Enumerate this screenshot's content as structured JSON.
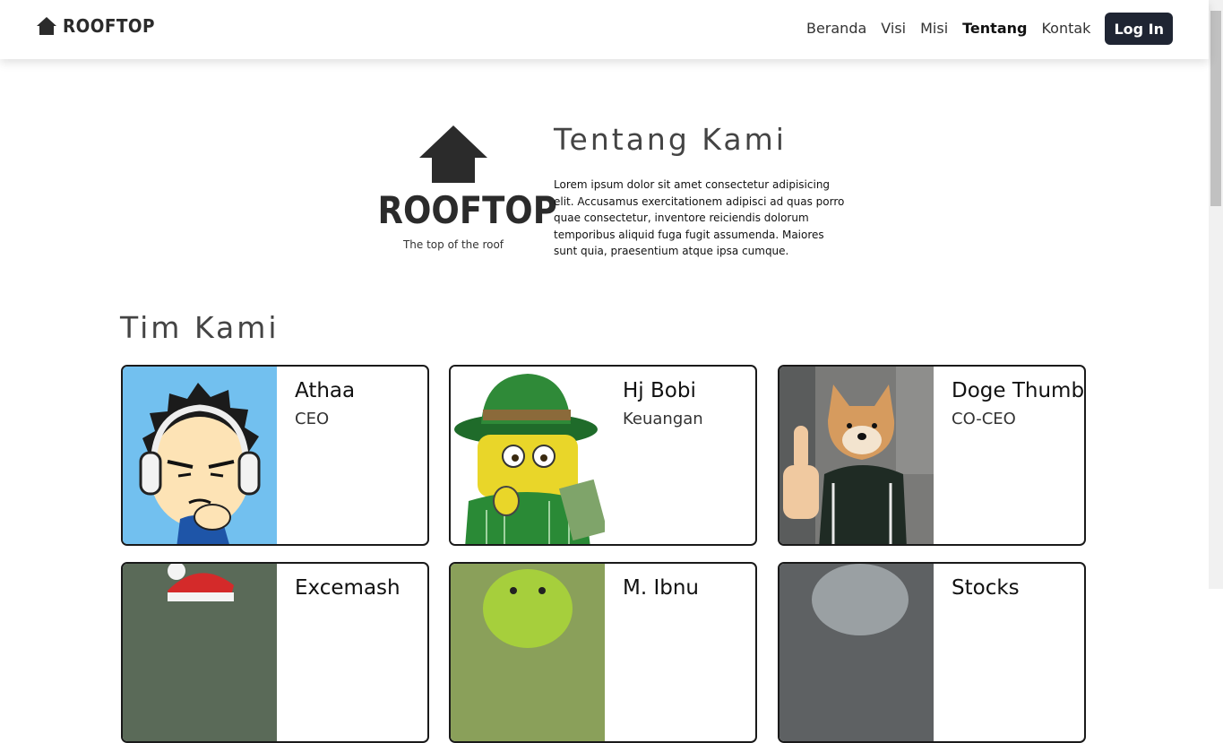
{
  "brand": {
    "name": "ROOFTOP",
    "icon": "house-icon"
  },
  "nav": {
    "links": [
      "Beranda",
      "Visi",
      "Misi",
      "Tentang",
      "Kontak"
    ],
    "active": "Tentang",
    "login_label": "Log In"
  },
  "about": {
    "logo_word": "ROOFTOP",
    "logo_tagline": "The top of the roof",
    "title": "Tentang Kami",
    "text": "Lorem ipsum dolor sit amet consectetur adipisicing elit. Accusamus exercitationem adipisci ad quas porro quae consectetur, inventore reiciendis dolorum temporibus aliquid fuga fugit assumenda. Maiores sunt quia, praesentium atque ipsa cumque."
  },
  "team": {
    "title": "Tim Kami",
    "members": [
      {
        "name": "Athaa",
        "role": "CEO"
      },
      {
        "name": "Hj Bobi",
        "role": "Keuangan"
      },
      {
        "name": "Doge Thumb",
        "role": "CO-CEO"
      },
      {
        "name": "Excemash",
        "role": ""
      },
      {
        "name": "M. Ibnu",
        "role": ""
      },
      {
        "name": "Stocks",
        "role": ""
      }
    ]
  },
  "colors": {
    "dark": "#1f2533",
    "text": "#444444",
    "card_border": "#1a1a1a"
  }
}
